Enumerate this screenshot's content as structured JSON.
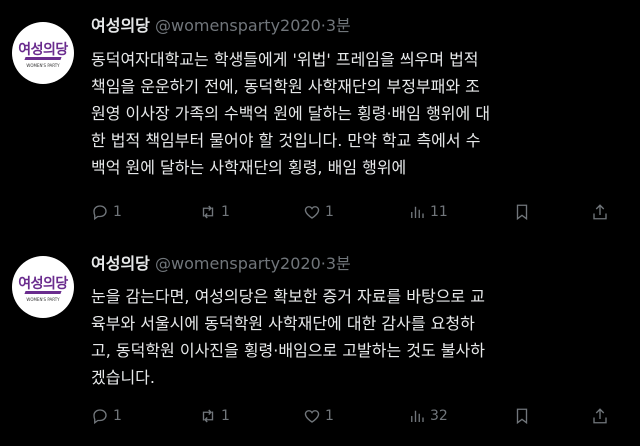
{
  "tweets": [
    {
      "avatar_logo": "여성의당",
      "avatar_sub": "WOMEN'S PARTY",
      "name": "여성의당",
      "handle": "@womensparty2020",
      "dot": "·",
      "time": "3분",
      "text": "동덕여자대학교는 학생들에게 '위법' 프레임을 씌우며 법적\n책임을 운운하기 전에, 동덕학원 사학재단의 부정부패와 조\n원영 이사장 가족의 수백억 원에 달하는 횡령·배임 행위에 대\n한 법적 책임부터 물어야 할 것입니다. 만약 학교 측에서 수\n백억 원에 달하는 사학재단의 횡령, 배임 행위에",
      "replies": "1",
      "retweets": "1",
      "likes": "1",
      "views": "11"
    },
    {
      "avatar_logo": "여성의당",
      "avatar_sub": "WOMEN'S PARTY",
      "name": "여성의당",
      "handle": "@womensparty2020",
      "dot": "·",
      "time": "3분",
      "text": "눈을 감는다면, 여성의당은 확보한 증거 자료를 바탕으로 교\n육부와 서울시에 동덕학원 사학재단에 대한 감사를 요청하\n고, 동덕학원 이사진을 횡령·배임으로 고발하는 것도 불사하\n겠습니다.",
      "replies": "1",
      "retweets": "1",
      "likes": "1",
      "views": "32"
    }
  ],
  "icons": [
    "reply-icon",
    "retweet-icon",
    "like-icon",
    "views-icon",
    "bookmark-icon",
    "share-icon"
  ]
}
